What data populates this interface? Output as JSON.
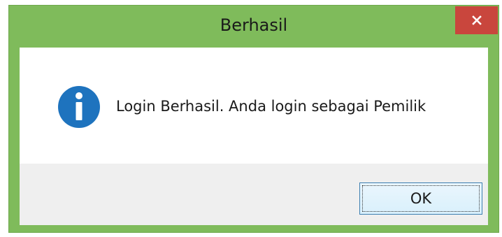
{
  "dialog": {
    "title": "Berhasil",
    "close_icon": "close-icon",
    "icon": "info-icon",
    "message": "Login Berhasil. Anda login sebagai Pemilik",
    "ok_label": "OK"
  },
  "colors": {
    "titlebar": "#7fbb5b",
    "close_button": "#c9463d",
    "info_icon": "#1e73be",
    "button_area": "#efefef"
  }
}
